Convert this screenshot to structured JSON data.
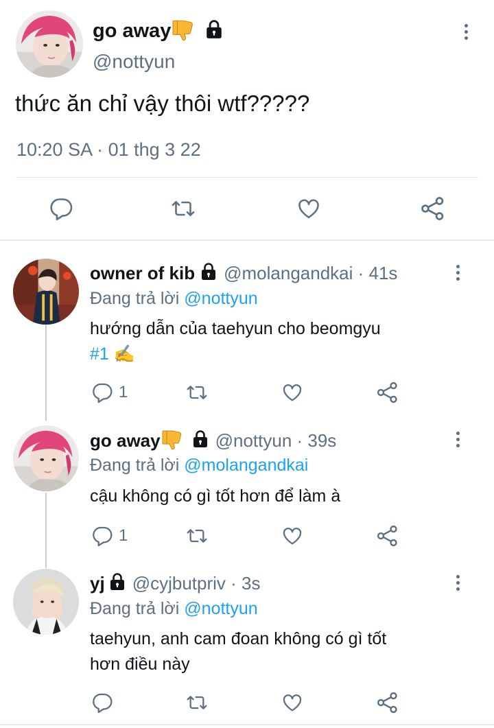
{
  "main_tweet": {
    "display_name": "go away",
    "name_emoji": "👎",
    "handle": "@nottyun",
    "text": "thức ăn chỉ vậy thôi wtf?????",
    "time": "10:20 SA · 01 thg 3 22"
  },
  "replies": [
    {
      "display_name": "owner of kib",
      "handle_time": "@molangandkai · 41s",
      "replying_prefix": "Đang trả lời",
      "replying_to": "@nottyun",
      "text_line1": "hướng dẫn của taehyun cho beomgyu",
      "hashtag": "#1",
      "hashtag_emoji": "✍️",
      "reply_count": "1"
    },
    {
      "display_name": "go away",
      "name_emoji": "👎",
      "handle_time": "@nottyun · 39s",
      "replying_prefix": "Đang trả lời",
      "replying_to": "@molangandkai",
      "text": "cậu không có gì tốt hơn để làm à",
      "reply_count": "1"
    },
    {
      "display_name": "yj",
      "handle_time": "@cyjbutpriv · 3s",
      "replying_prefix": "Đang trả lời",
      "replying_to": "@nottyun",
      "text_line1": "taehyun, anh cam đoan không có gì tốt",
      "text_line2": "hơn điều này"
    }
  ],
  "icons": [
    "reply-icon",
    "retweet-icon",
    "like-icon",
    "share-icon",
    "lock-icon",
    "more-icon"
  ],
  "colors": {
    "accent": "#1da1f2",
    "secondary_text": "#5b7083",
    "divider": "#e6ecf0",
    "avatar_hair": "#e0457b"
  }
}
